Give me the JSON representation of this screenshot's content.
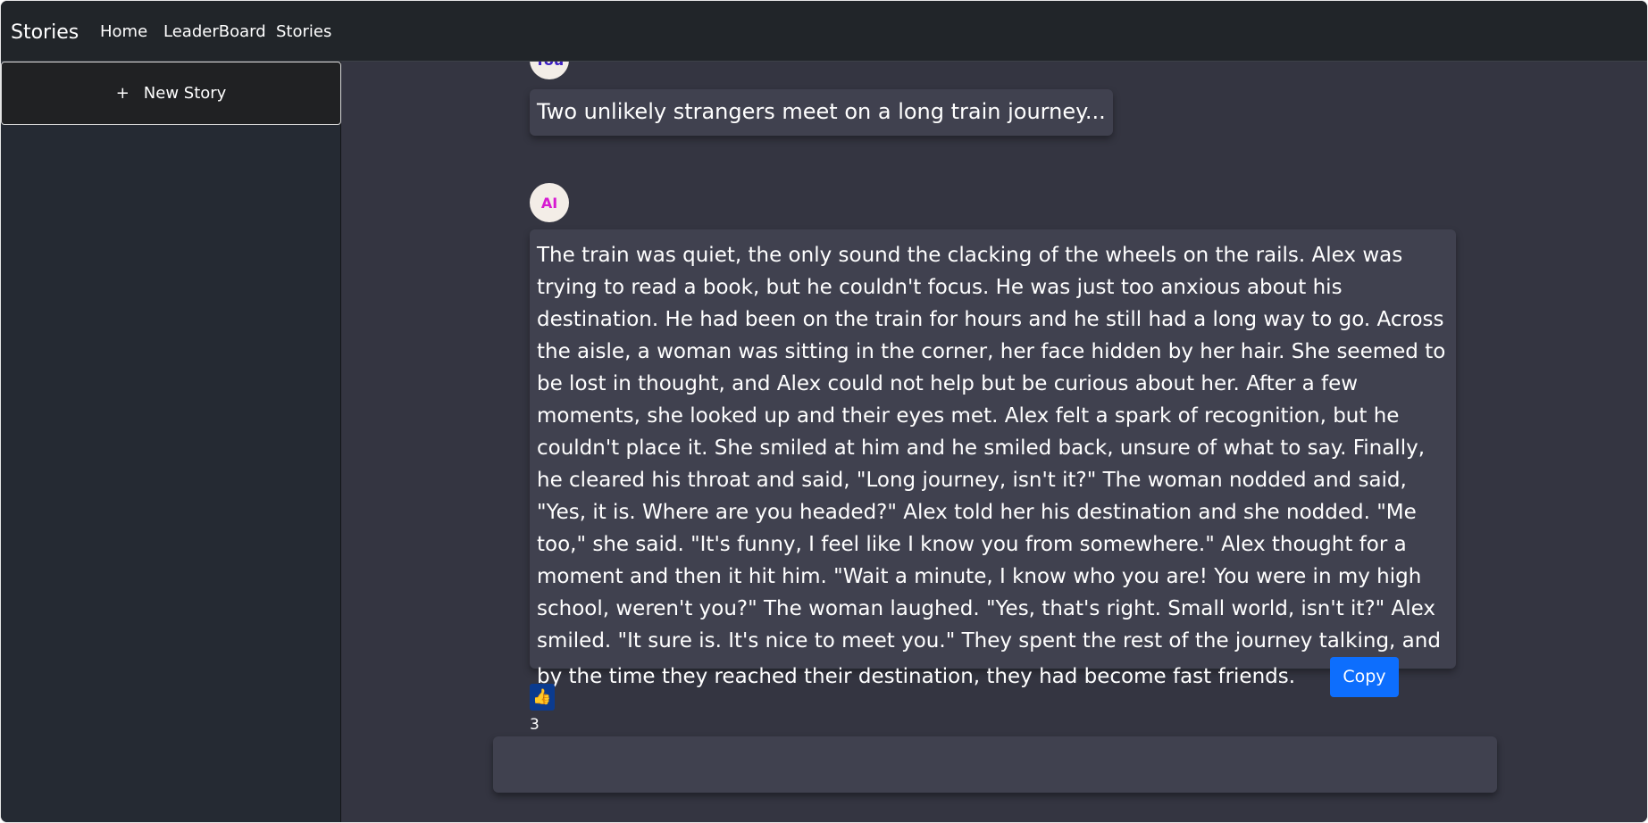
{
  "navbar": {
    "brand": "Stories",
    "links": [
      "Home",
      "LeaderBoard",
      "Stories"
    ]
  },
  "sidebar": {
    "new_story_icon": "+",
    "new_story_label": "New Story"
  },
  "chat": {
    "user_avatar": "You",
    "user_message": "Two unlikely strangers meet on a long train journey...",
    "ai_avatar": "AI",
    "ai_message": "The train was quiet, the only sound the clacking of the wheels on the rails. Alex was trying to read a book, but he couldn't focus. He was just too anxious about his destination. He had been on the train for hours and he still had a long way to go. Across the aisle, a woman was sitting in the corner, her face hidden by her hair. She seemed to be lost in thought, and Alex could not help but be curious about her. After a few moments, she looked up and their eyes met. Alex felt a spark of recognition, but he couldn't place it. She smiled at him and he smiled back, unsure of what to say. Finally, he cleared his throat and said, \"Long journey, isn't it?\" The woman nodded and said, \"Yes, it is. Where are you headed?\" Alex told her his destination and she nodded. \"Me too,\" she said. \"It's funny, I feel like I know you from somewhere.\" Alex thought for a moment and then it hit him. \"Wait a minute, I know who you are! You were in my high school, weren't you?\" The woman laughed. \"Yes, that's right. Small world, isn't it?\" Alex smiled. \"It sure is. It's nice to meet you.\" They spent the rest of the journey talking, and by the time they reached their destination, they had become fast friends.",
    "copy_label": "Copy",
    "like_icon": "👍",
    "like_icon_name": "thumbs-up-icon",
    "like_count": "3"
  },
  "input": {
    "value": "",
    "placeholder": ""
  },
  "colors": {
    "navbar_bg": "#212529",
    "sidebar_bg": "#252a33",
    "main_bg": "#343541",
    "bubble_bg": "#40414f",
    "copy_button": "#0d6efd",
    "user_avatar_text": "#3d1fc2",
    "ai_avatar_text": "#d61bd1"
  }
}
